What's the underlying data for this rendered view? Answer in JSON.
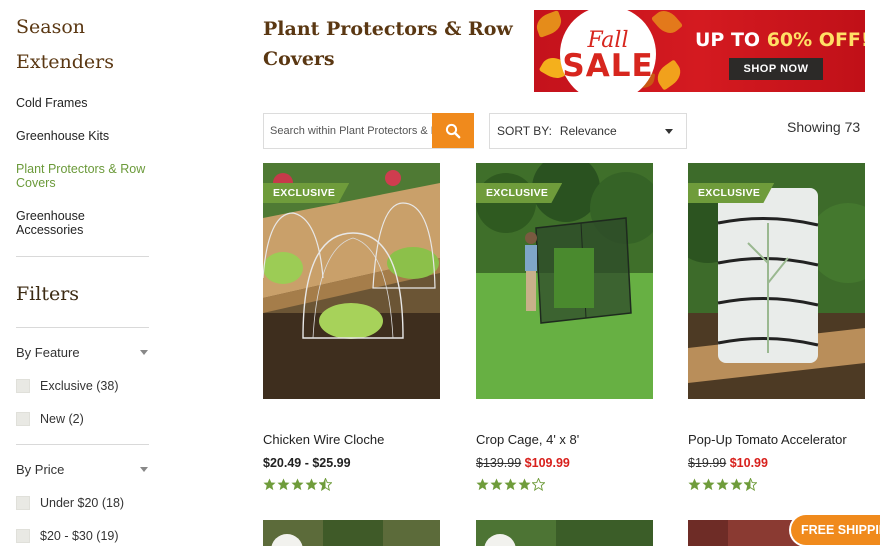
{
  "sidebar": {
    "title_line1": "Season",
    "title_line2": "Extenders",
    "categories": [
      {
        "label": "Cold Frames"
      },
      {
        "label": "Greenhouse Kits"
      },
      {
        "label": "Plant Protectors & Row Covers"
      },
      {
        "label": "Greenhouse Accessories"
      }
    ],
    "filters_title": "Filters",
    "by_feature": {
      "label": "By Feature",
      "options": [
        {
          "label": "Exclusive (38)"
        },
        {
          "label": "New (2)"
        }
      ]
    },
    "by_price": {
      "label": "By Price",
      "options": [
        {
          "label": "Under $20 (18)"
        },
        {
          "label": "$20 - $30 (19)"
        }
      ]
    }
  },
  "main": {
    "page_title": "Plant Protectors & Row Covers",
    "banner": {
      "fall": "Fall",
      "sale": "SALE",
      "offer_prefix": "UP TO ",
      "offer_pct": "60% OFF!",
      "cta": "SHOP NOW"
    },
    "search": {
      "placeholder": "Search within Plant Protectors & Row Covers"
    },
    "sort": {
      "label": "SORT BY:",
      "value": "Relevance"
    },
    "showing": "Showing 73",
    "products": [
      {
        "badge": "EXCLUSIVE",
        "name": "Chicken Wire Cloche",
        "price": "$20.49 - $25.99",
        "old_price": "",
        "sale_price": "",
        "rating": 4.5
      },
      {
        "badge": "EXCLUSIVE",
        "name": "Crop Cage, 4' x 8'",
        "price": "",
        "old_price": "$139.99",
        "sale_price": "$109.99",
        "rating": 4
      },
      {
        "badge": "EXCLUSIVE",
        "name": "Pop-Up Tomato Accelerator",
        "price": "",
        "old_price": "$19.99",
        "sale_price": "$10.99",
        "rating": 4.5
      }
    ]
  },
  "free_shipping": "FREE SHIPPING",
  "colors": {
    "title_brown": "#5a3712",
    "accent_green": "#6f9c3b",
    "accent_orange": "#f08a1c",
    "sale_red": "#d8201c",
    "banner_red": "#c4121c"
  }
}
